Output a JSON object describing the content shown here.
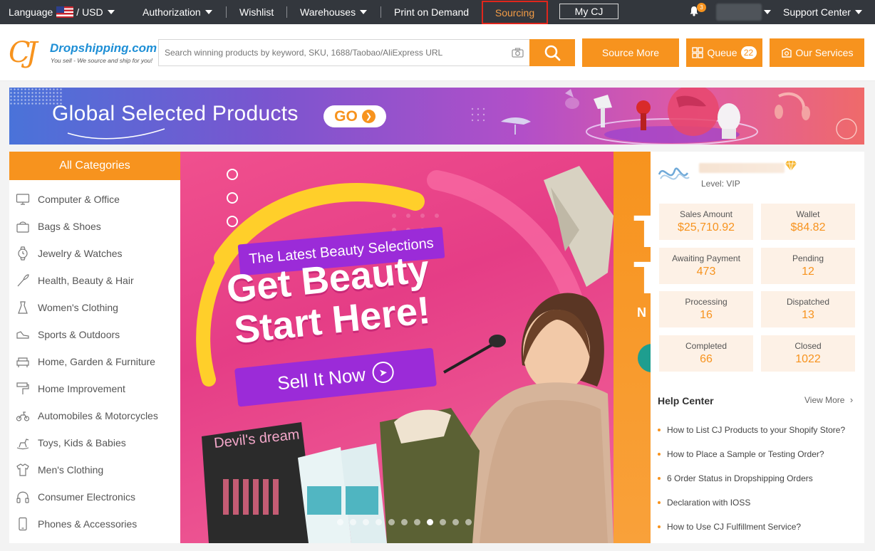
{
  "topbar": {
    "language_label": "Language",
    "currency_label": "/ USD",
    "authorization": "Authorization",
    "wishlist": "Wishlist",
    "warehouses": "Warehouses",
    "print_on_demand": "Print on Demand",
    "sourcing": "Sourcing",
    "my_cj": "My CJ",
    "notification_count": "3",
    "support_center": "Support Center"
  },
  "header": {
    "logo_mark": "CJ",
    "logo_name": "Dropshipping.com",
    "logo_tagline": "You sell - We source and ship for you!",
    "search_placeholder": "Search winning products by keyword, SKU, 1688/Taobao/AliExpress URL",
    "source_more": "Source More",
    "queue_label": "Queue",
    "queue_count": "22",
    "our_services": "Our Services"
  },
  "promo": {
    "title": "Global Selected Products",
    "go_label": "GO"
  },
  "categories": {
    "header": "All Categories",
    "items": [
      {
        "label": "Computer & Office",
        "icon": "computer-icon"
      },
      {
        "label": "Bags & Shoes",
        "icon": "bag-icon"
      },
      {
        "label": "Jewelry & Watches",
        "icon": "watch-icon"
      },
      {
        "label": "Health, Beauty & Hair",
        "icon": "brush-icon"
      },
      {
        "label": "Women's Clothing",
        "icon": "dress-icon"
      },
      {
        "label": "Sports & Outdoors",
        "icon": "sneaker-icon"
      },
      {
        "label": "Home, Garden & Furniture",
        "icon": "sofa-icon"
      },
      {
        "label": "Home Improvement",
        "icon": "paint-roller-icon"
      },
      {
        "label": "Automobiles & Motorcycles",
        "icon": "motorcycle-icon"
      },
      {
        "label": "Toys, Kids & Babies",
        "icon": "rocking-horse-icon"
      },
      {
        "label": "Men's Clothing",
        "icon": "shirt-icon"
      },
      {
        "label": "Consumer Electronics",
        "icon": "headphones-icon"
      },
      {
        "label": "Phones & Accessories",
        "icon": "phone-icon"
      }
    ]
  },
  "hero": {
    "tag": "The Latest Beauty Selections",
    "headline_1": "Get Beauty",
    "headline_2": "Start Here!",
    "cta": "Sell It Now",
    "product_text": "Devil's dream",
    "slide_count": 11,
    "active_slide": 8
  },
  "hero_next": {
    "big_1": "T",
    "big_2": "T",
    "small": "N"
  },
  "account": {
    "level": "Level: VIP",
    "stats": [
      {
        "label": "Sales Amount",
        "value": "$25,710.92"
      },
      {
        "label": "Wallet",
        "value": "$84.82"
      },
      {
        "label": "Awaiting Payment",
        "value": "473"
      },
      {
        "label": "Pending",
        "value": "12"
      },
      {
        "label": "Processing",
        "value": "16"
      },
      {
        "label": "Dispatched",
        "value": "13"
      },
      {
        "label": "Completed",
        "value": "66"
      },
      {
        "label": "Closed",
        "value": "1022"
      }
    ]
  },
  "help_center": {
    "title": "Help Center",
    "view_more": "View More",
    "items": [
      "How to List CJ Products to your Shopify Store?",
      "How to Place a Sample or Testing Order?",
      "6 Order Status in Dropshipping Orders",
      "Declaration with IOSS",
      "How to Use CJ Fulfillment Service?"
    ]
  },
  "colors": {
    "brand_orange": "#f7931e",
    "topbar_bg": "#33373d",
    "logo_blue": "#1e8fd6",
    "highlight_red": "#e0261c"
  }
}
